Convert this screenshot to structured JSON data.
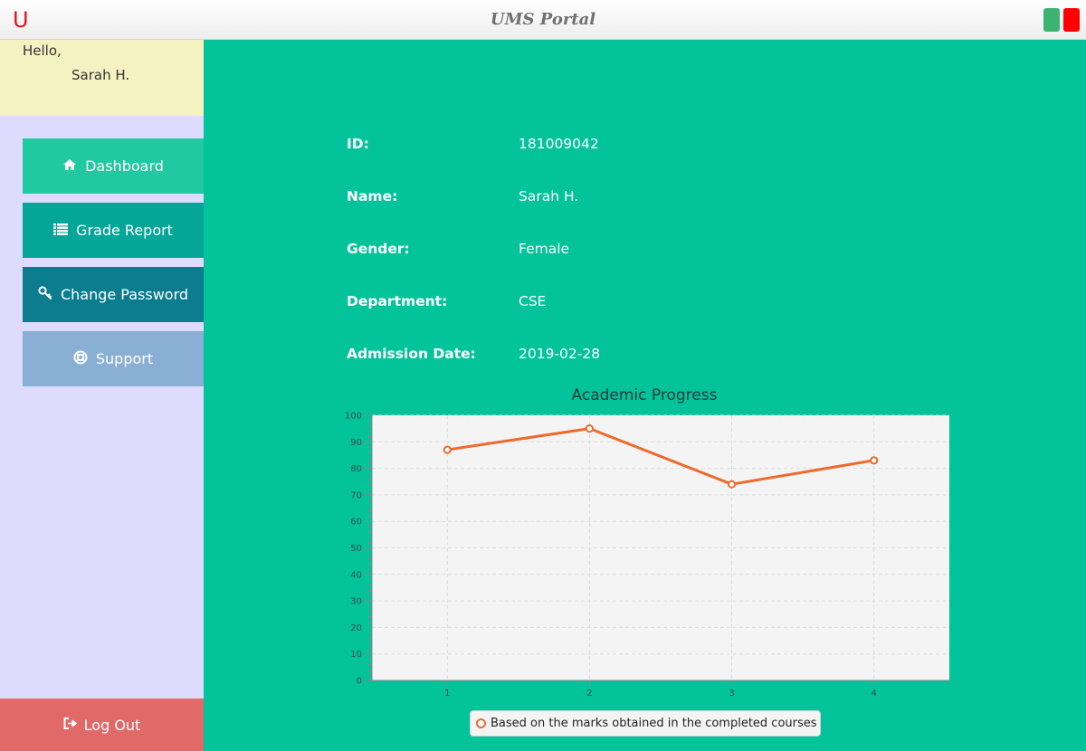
{
  "window": {
    "logo": "U",
    "title": "UMS Portal"
  },
  "greeting": {
    "hello": "Hello,",
    "name": "Sarah H."
  },
  "nav": {
    "dashboard": "Dashboard",
    "grade_report": "Grade Report",
    "change_password": "Change Password",
    "support": "Support",
    "logout": "Log Out"
  },
  "icons": {
    "dashboard": "home-icon",
    "grade_report": "list-icon",
    "change_password": "key-icon",
    "support": "life-ring-icon",
    "logout": "sign-out-icon"
  },
  "profile": [
    {
      "label": "ID:",
      "value": "181009042"
    },
    {
      "label": "Name:",
      "value": "Sarah H."
    },
    {
      "label": "Gender:",
      "value": "Female"
    },
    {
      "label": "Department:",
      "value": "CSE"
    },
    {
      "label": "Admission Date:",
      "value": "2019-02-28"
    }
  ],
  "colors": {
    "background": "#02c39a",
    "dashboard": "#20c99f",
    "grade_report": "#03a697",
    "change_password": "#0b7d8f",
    "support": "#8aafd5",
    "logout": "#e16a69",
    "series": "#ee6a2c"
  },
  "chart_data": {
    "type": "line",
    "title": "Academic Progress",
    "xlabel": "",
    "ylabel": "",
    "x": [
      1,
      2,
      3,
      4
    ],
    "ylim": [
      0,
      100
    ],
    "yticks": [
      0,
      10,
      20,
      30,
      40,
      50,
      60,
      70,
      80,
      90,
      100
    ],
    "grid": true,
    "legend_position": "bottom",
    "series": [
      {
        "name": "Based on the marks obtained in the completed courses",
        "values": [
          87,
          95,
          74,
          83
        ]
      }
    ]
  }
}
